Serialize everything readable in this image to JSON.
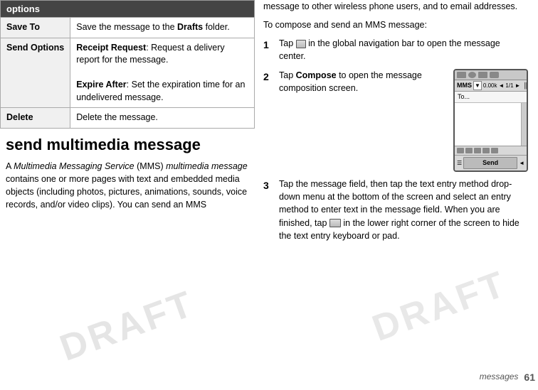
{
  "left": {
    "table": {
      "header": "options",
      "rows": [
        {
          "label": "Save To",
          "content": "Save the message to the <b>Drafts</b> folder."
        },
        {
          "label": "Send Options",
          "content": "<b>Receipt Request</b>: Request a delivery report for the message.<br><b>Expire After</b>: Set the expiration time for an undelivered message."
        },
        {
          "label": "Delete",
          "content": "Delete the message."
        }
      ]
    },
    "section_title": "send multimedia message",
    "intro": "A Multimedia Messaging Service (MMS) multimedia message contains one or more pages with text and embedded media objects (including photos, pictures, animations, sounds, voice records, and/or video clips). You can send an MMS"
  },
  "right": {
    "intro_continued": "message to other wireless phone users, and to email addresses.",
    "steps_intro": "To compose and send an MMS message:",
    "steps": [
      {
        "num": "1",
        "text": "Tap",
        "icon": "nav-icon",
        "text2": "in the global navigation bar to open the message center."
      },
      {
        "num": "2",
        "text": "Tap",
        "bold": "Compose",
        "text2": "to open the message composition screen."
      },
      {
        "num": "3",
        "text": "Tap the message field, then tap the text entry method drop-down menu at the bottom of the screen and select an entry method to enter text in the message field. When you are finished, tap",
        "icon": "keyboard-hide-icon",
        "text2": "in the lower right corner of the screen to hide the text entry keyboard or pad."
      }
    ],
    "phone_mockup": {
      "mms_label": "MMS",
      "size": "0.00k",
      "counter": "1/1",
      "to_placeholder": "To...",
      "send_label": "Send"
    },
    "footer": {
      "label": "messages",
      "page": "61"
    }
  },
  "watermark": "DRAFT"
}
